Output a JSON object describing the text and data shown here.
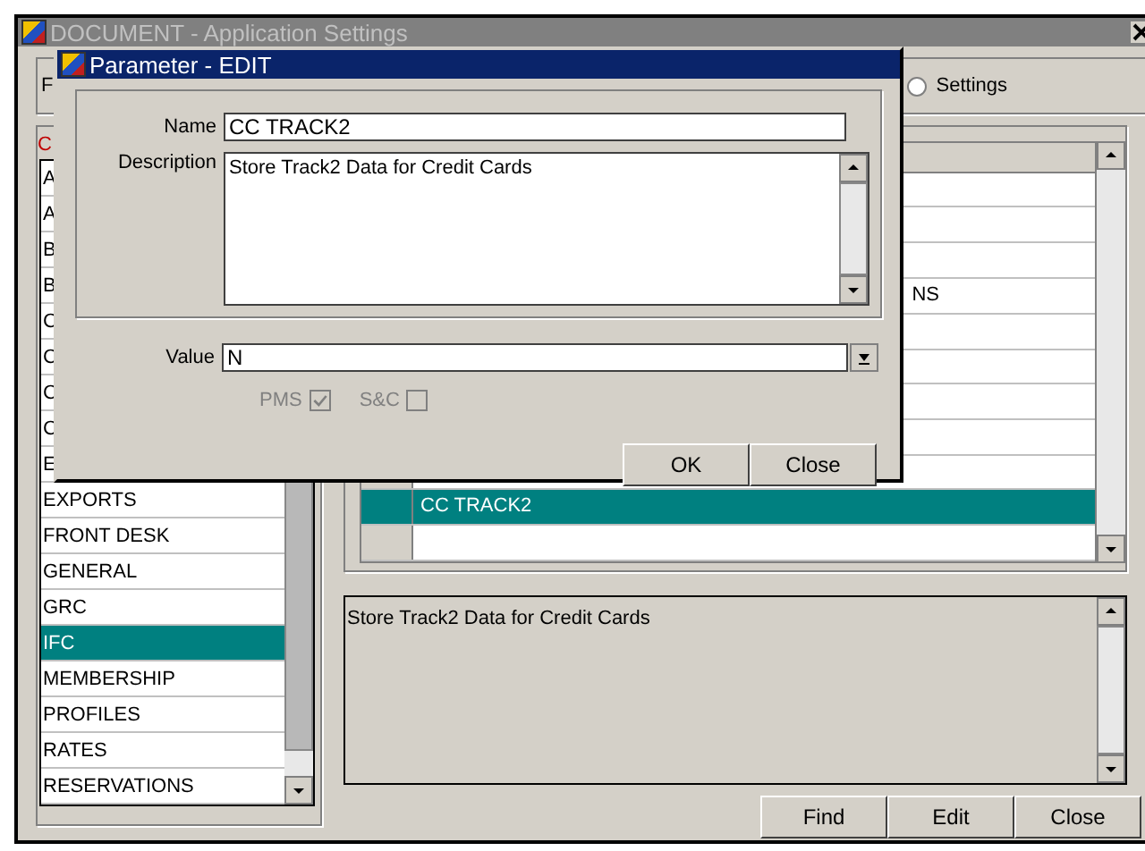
{
  "main_window": {
    "title": "DOCUMENT - Application Settings",
    "option_fragment": "F",
    "settings_radio": {
      "label": "Settings",
      "selected": false
    },
    "groups_caption": "C",
    "groups": [
      {
        "label": "A"
      },
      {
        "label": "A"
      },
      {
        "label": "B"
      },
      {
        "label": "B"
      },
      {
        "label": "C"
      },
      {
        "label": "C"
      },
      {
        "label": "C"
      },
      {
        "label": "C"
      },
      {
        "label": "E"
      },
      {
        "label": "EXPORTS",
        "selected": false
      },
      {
        "label": "FRONT DESK",
        "selected": false
      },
      {
        "label": "GENERAL",
        "selected": false
      },
      {
        "label": "GRC",
        "selected": false
      },
      {
        "label": "IFC",
        "selected": true
      },
      {
        "label": "MEMBERSHIP",
        "selected": false
      },
      {
        "label": "PROFILES",
        "selected": false
      },
      {
        "label": "RATES",
        "selected": false
      },
      {
        "label": "RESERVATIONS",
        "selected": false
      }
    ],
    "parameters": [
      {
        "selected": false
      },
      {
        "selected": false
      },
      {
        "selected": false
      },
      {
        "name": "NS",
        "kind": "covered",
        "selected": false
      },
      {
        "selected": false
      },
      {
        "selected": false
      },
      {
        "selected": false
      },
      {
        "selected": false
      },
      {
        "selected": false
      },
      {
        "name": "CC TRACK2",
        "kind": "plain",
        "selected": true
      },
      {
        "kind": "plain",
        "selected": false
      }
    ],
    "description": "Store Track2 Data for Credit Cards",
    "buttons": [
      "Find",
      "Edit",
      "Close"
    ]
  },
  "dialog": {
    "title": "Parameter - EDIT",
    "name_label": "Name",
    "name": "CC TRACK2",
    "description_label": "Description",
    "description": "Store Track2 Data for Credit Cards",
    "value_label": "Value",
    "value": "N",
    "checkboxes": [
      {
        "label": "PMS",
        "checked": true,
        "disabled": true
      },
      {
        "label": "S&C",
        "checked": false,
        "disabled": true
      }
    ],
    "buttons": [
      "OK",
      "Close"
    ]
  }
}
